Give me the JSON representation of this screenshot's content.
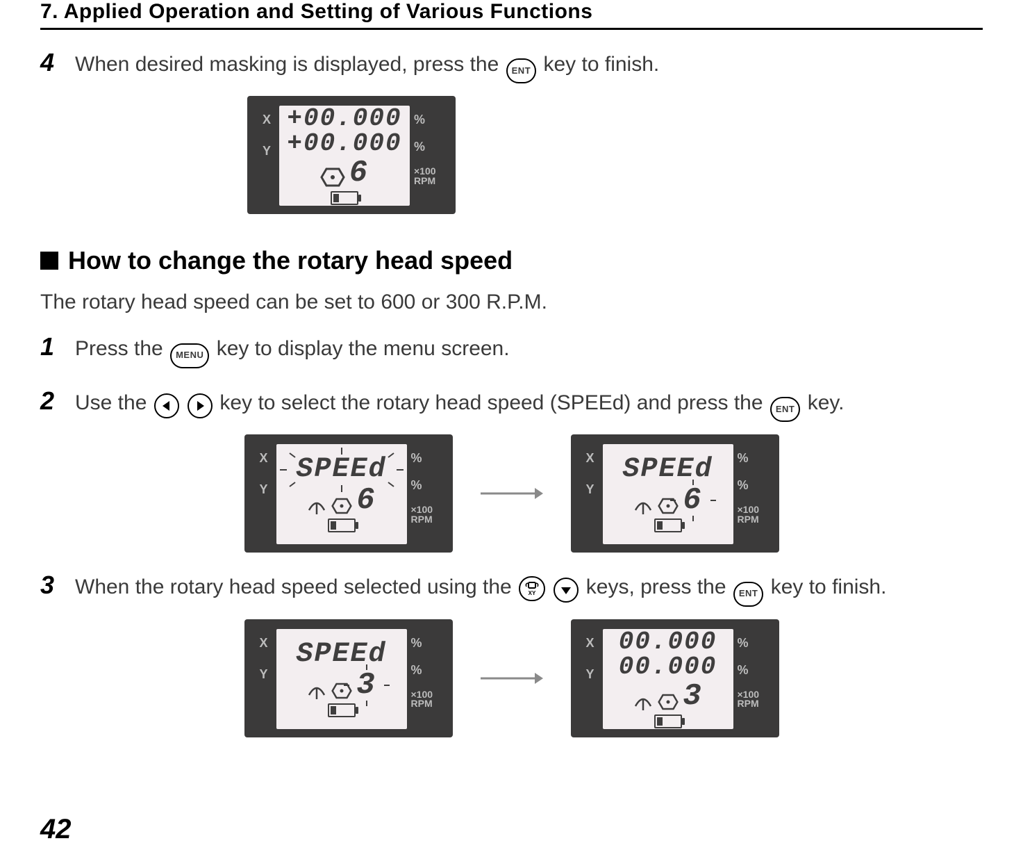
{
  "chapter_heading": "7.  Applied Operation and Setting of Various Functions",
  "step4": {
    "num": "4",
    "pre": "When desired masking is displayed, press the ",
    "post": " key to finish."
  },
  "lcd1": {
    "x": "X",
    "y": "Y",
    "pct": "%",
    "row1": "+00.000",
    "row2": "+00.000",
    "digit": "6",
    "rpm_mult": "×100",
    "rpm": "RPM"
  },
  "section_heading": "How to change the rotary head speed",
  "intro": "The rotary head speed can be set to 600 or 300 R.P.M.",
  "step1": {
    "num": "1",
    "pre": "Press the ",
    "post": " key to display the menu screen."
  },
  "step2": {
    "num": "2",
    "pre": "Use the ",
    "mid": " key to select the rotary head speed (SPEEd) and press the ",
    "post": " key."
  },
  "lcd2a": {
    "speed": "SPEEd",
    "digit": "6"
  },
  "lcd2b": {
    "speed": "SPEEd",
    "digit": "6"
  },
  "step3": {
    "num": "3",
    "pre": "When the rotary head speed selected using the ",
    "mid": " keys, press the ",
    "post": " key to finish."
  },
  "lcd3a": {
    "speed": "SPEEd",
    "digit": "3"
  },
  "lcd3b": {
    "row1": "00.000",
    "row2": "00.000",
    "digit": "3"
  },
  "labels": {
    "x": "X",
    "y": "Y",
    "pct": "%",
    "rpm_mult": "×100",
    "rpm": "RPM"
  },
  "keys": {
    "ent": "ENT",
    "menu": "MENU",
    "xy": "XY"
  },
  "page_number": "42"
}
